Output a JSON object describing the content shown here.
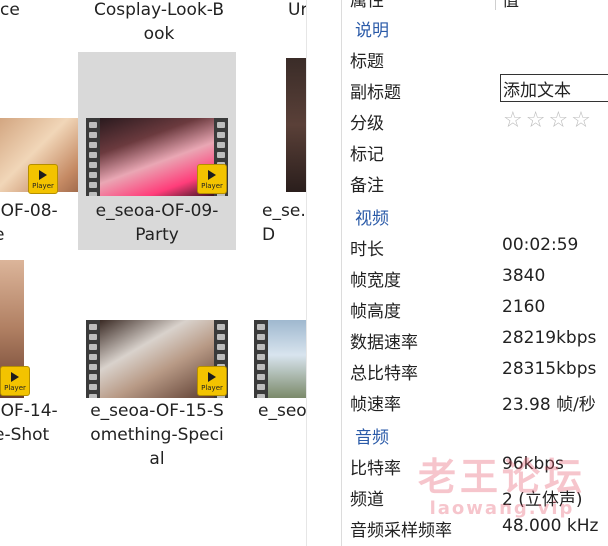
{
  "files": {
    "names": {
      "cosplay": "Cosplay-Look-B\nook",
      "top_right_cut": "Ur",
      "top_left_cut": "ce",
      "of08": "-OF-08-\ne",
      "of09": "e_seoa-OF-09-\nParty",
      "col3_row2": "e_se…\nD",
      "of14": "-OF-14-\ne-Shot",
      "of15": "e_seoa-OF-15-S\nomething-Speci\nal",
      "col3_row3": "e_seo"
    },
    "player_label": "Player"
  },
  "panel": {
    "top_cut": {
      "label": "属性",
      "value": "值"
    },
    "sections": {
      "description": "说明",
      "video": "视频",
      "audio": "音频"
    },
    "description": {
      "title_label": "标题",
      "subtitle_label": "副标题",
      "subtitle_value": "添加文本",
      "rating_label": "分级",
      "rating_stars": "☆☆☆☆",
      "rating": 0,
      "tags_label": "标记",
      "comments_label": "备注"
    },
    "video": [
      {
        "label": "时长",
        "value": "00:02:59"
      },
      {
        "label": "帧宽度",
        "value": "3840"
      },
      {
        "label": "帧高度",
        "value": "2160"
      },
      {
        "label": "数据速率",
        "value": "28219kbps"
      },
      {
        "label": "总比特率",
        "value": "28315kbps"
      },
      {
        "label": "帧速率",
        "value": "23.98 帧/秒"
      }
    ],
    "audio": [
      {
        "label": "比特率",
        "value": "96kbps"
      },
      {
        "label": "频道",
        "value": "2 (立体声)"
      },
      {
        "label": "音频采样频率",
        "value": "48.000 kHz"
      }
    ]
  },
  "watermark": {
    "line1": "老王论坛",
    "line2": "laowang.vip"
  },
  "colors": {
    "section": "#2a5aa8",
    "selected_tile": "#d9d9d9",
    "player_badge": "#f3c300",
    "film_strip": "#3a3a3a"
  }
}
